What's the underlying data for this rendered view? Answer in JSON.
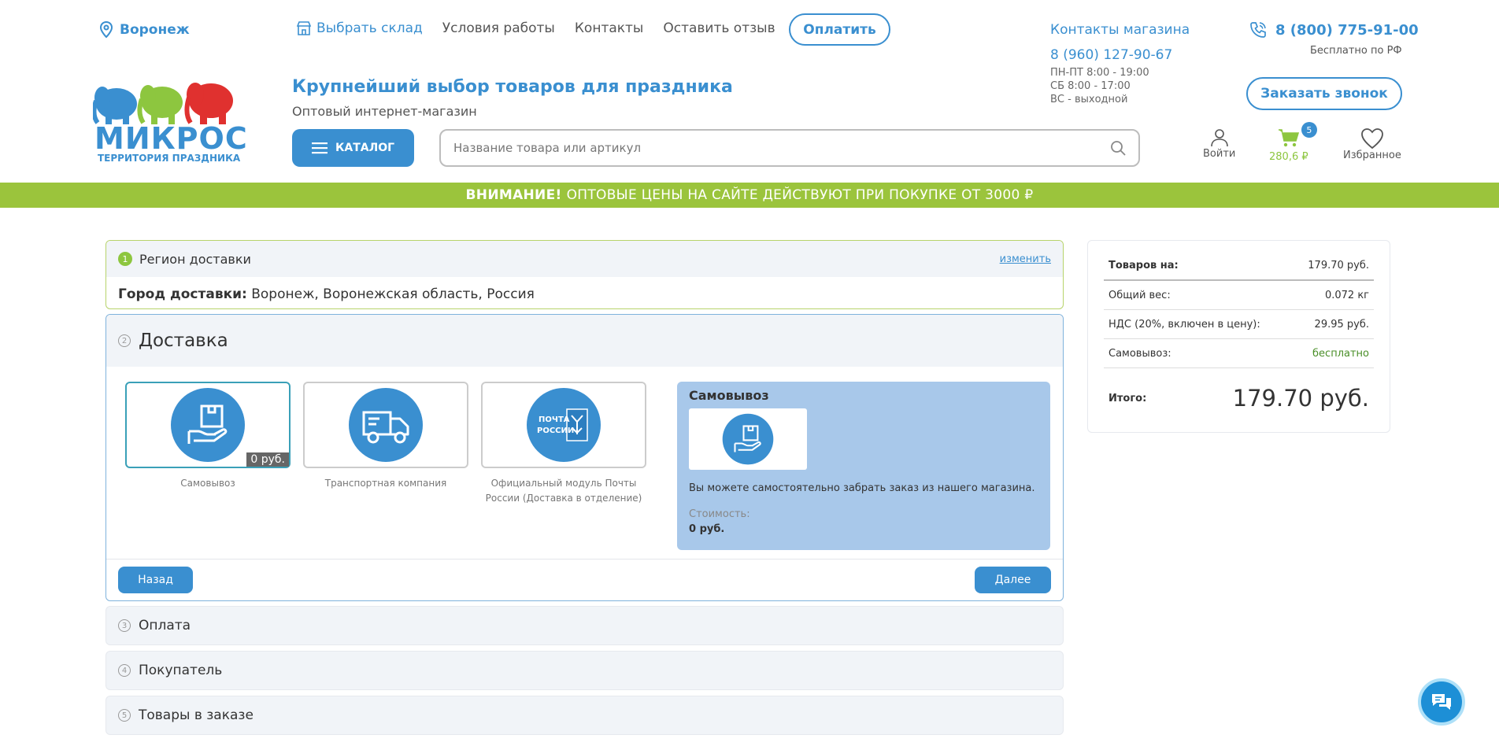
{
  "header": {
    "city": "Воронеж",
    "nav": [
      "Выбрать склад",
      "Условия работы",
      "Контакты",
      "Оставить отзыв"
    ],
    "pay_label": "Оплатить",
    "shop_contacts_title": "Контакты магазина",
    "shop_phone": "8 (960) 127-90-67",
    "hours": [
      "ПН-ПТ 8:00 - 19:00",
      "СБ 8:00 - 17:00",
      "ВС - выходной"
    ],
    "main_phone": "8 (800) 775-91-00",
    "free_call": "Бесплатно по РФ",
    "callback_label": "Заказать звонок",
    "logo_text": "МИКРОС",
    "logo_sub": "ТЕРРИТОРИЯ ПРАЗДНИКА",
    "tagline": "Крупнейший выбор товаров для праздника",
    "tagline_sub": "Оптовый интернет-магазин",
    "catalog_label": "КАТАЛОГ",
    "search_placeholder": "Название товара или артикул",
    "login_label": "Войти",
    "cart_count": "5",
    "cart_sum": "280,6 ₽",
    "fav_label": "Избранное"
  },
  "banner": {
    "bold": "ВНИМАНИЕ!",
    "text": "ОПТОВЫЕ ЦЕНЫ НА САЙТЕ ДЕЙСТВУЮТ ПРИ ПОКУПКЕ ОТ 3000 ₽"
  },
  "steps": {
    "region": {
      "num": "1",
      "title": "Регион доставки",
      "change": "изменить",
      "city_label": "Город доставки:",
      "city_value": "Воронеж, Воронежская область, Россия"
    },
    "delivery": {
      "num": "2",
      "title": "Доставка",
      "options": [
        {
          "label": "Самовывоз",
          "price": "0 руб.",
          "icon": "pickup-hand-box-icon"
        },
        {
          "label": "Транспортная компания",
          "icon": "truck-icon"
        },
        {
          "label": "Официальный модуль Почты России (Доставка в отделение)",
          "icon": "russian-post-logo",
          "logo_text": "ПОЧТА РОССИИ"
        }
      ],
      "detail": {
        "title": "Самовывоз",
        "desc": "Вы можете самостоятельно забрать заказ из нашего магазина.",
        "cost_label": "Стоимость:",
        "cost": "0 руб."
      },
      "back_label": "Назад",
      "next_label": "Далее"
    },
    "payment": {
      "num": "3",
      "title": "Оплата"
    },
    "buyer": {
      "num": "4",
      "title": "Покупатель"
    },
    "items": {
      "num": "5",
      "title": "Товары в заказе"
    }
  },
  "summary": {
    "rows": [
      {
        "label": "Товаров на:",
        "value": "179.70 руб."
      },
      {
        "label": "Общий вес:",
        "value": "0.072 кг"
      },
      {
        "label": "НДС (20%, включен в цену):",
        "value": "29.95 руб."
      },
      {
        "label": "Самовывоз:",
        "value": "бесплатно"
      }
    ],
    "total_label": "Итого:",
    "total_value": "179.70 руб."
  },
  "colors": {
    "accent": "#3a8fd0",
    "green": "#9bc43c",
    "panel": "#a8c8ea"
  }
}
